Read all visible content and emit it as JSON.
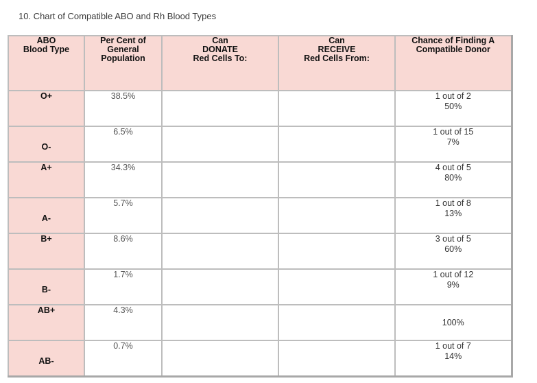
{
  "title": "10.  Chart of Compatible ABO and Rh Blood Types",
  "headers": {
    "blood_type": [
      "ABO",
      "Blood Type"
    ],
    "percent": [
      "Per Cent of",
      "General",
      "Population"
    ],
    "donate": [
      "Can",
      "DONATE",
      "Red Cells To:"
    ],
    "receive": [
      "Can",
      "RECEIVE",
      "Red Cells From:"
    ],
    "chance": [
      "Chance of Finding A",
      "Compatible Donor"
    ]
  },
  "rows": [
    {
      "type": "O+",
      "percent": "38.5%",
      "donate": "",
      "receive": "",
      "chance_ratio": "1 out of 2",
      "chance_pct": "50%"
    },
    {
      "type": "O-",
      "percent": "6.5%",
      "donate": "",
      "receive": "",
      "chance_ratio": "1 out of 15",
      "chance_pct": "7%"
    },
    {
      "type": "A+",
      "percent": "34.3%",
      "donate": "",
      "receive": "",
      "chance_ratio": "4 out of 5",
      "chance_pct": "80%"
    },
    {
      "type": "A-",
      "percent": "5.7%",
      "donate": "",
      "receive": "",
      "chance_ratio": "1 out of 8",
      "chance_pct": "13%"
    },
    {
      "type": "B+",
      "percent": "8.6%",
      "donate": "",
      "receive": "",
      "chance_ratio": "3 out of 5",
      "chance_pct": "60%"
    },
    {
      "type": "B-",
      "percent": "1.7%",
      "donate": "",
      "receive": "",
      "chance_ratio": "1 out of 12",
      "chance_pct": "9%"
    },
    {
      "type": "AB+",
      "percent": "4.3%",
      "donate": "",
      "receive": "",
      "chance_ratio": "",
      "chance_pct": "100%"
    },
    {
      "type": "AB-",
      "percent": "0.7%",
      "donate": "",
      "receive": "",
      "chance_ratio": "1 out of 7",
      "chance_pct": "14%"
    }
  ],
  "colors": {
    "header_bg": "#f9d9d4",
    "type_col_bg": "#f9d9d4",
    "border": "#bdbdbd"
  }
}
